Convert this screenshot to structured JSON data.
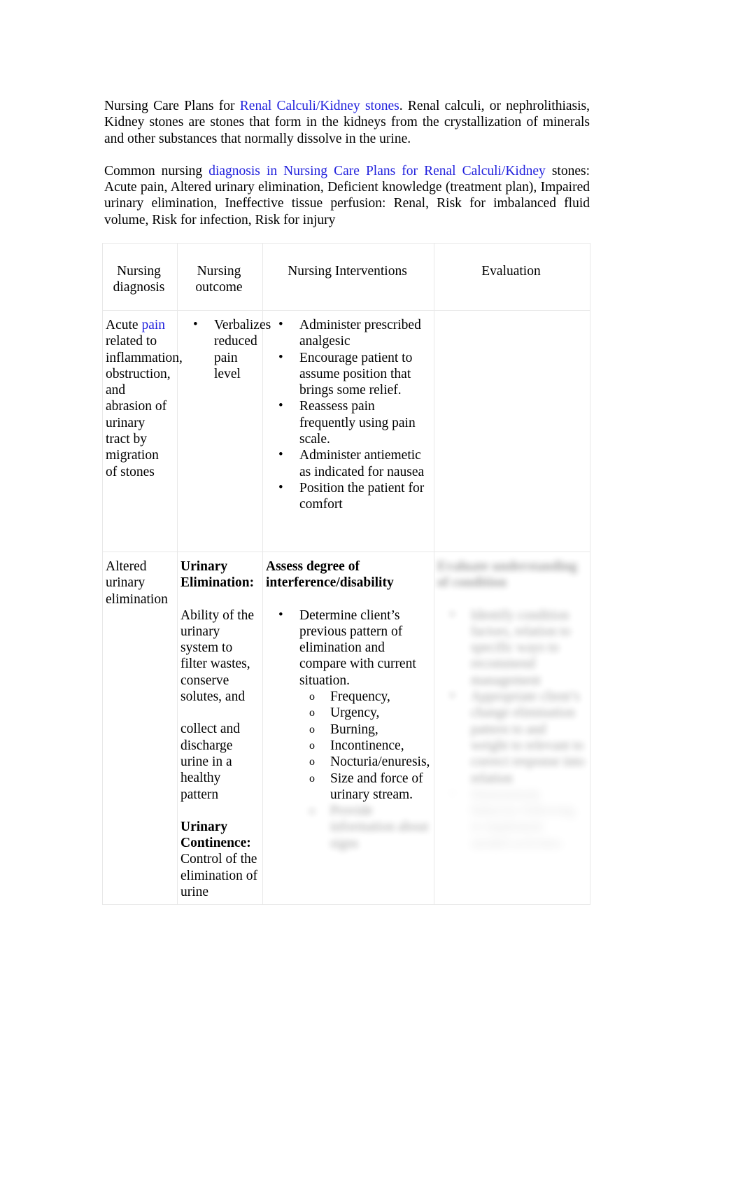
{
  "document": {
    "intro_paragraph": {
      "lead": "Nursing Care Plans for ",
      "link": "Renal Calculi/Kidney stones",
      "rest": ". Renal calculi, or nephrolithiasis, Kidney stones are stones that form in the kidneys from the crystallization of minerals and other substances that normally dissolve in the urine."
    },
    "second_paragraph": {
      "lead": "Common nursing ",
      "link": "diagnosis  in Nursing Care Plans for Renal Calculi/Kidney",
      "rest": " stones: Acute pain, Altered urinary elimination, Deficient knowledge (treatment plan), Impaired urinary elimination, Ineffective tissue perfusion: Renal, Risk for imbalanced fluid volume, Risk for infection, Risk for injury"
    }
  },
  "table": {
    "headers": {
      "diagnosis": "Nursing diagnosis",
      "outcome": "Nursing outcome",
      "interventions": "Nursing Interventions",
      "evaluation": "Evaluation"
    },
    "rows": [
      {
        "diagnosis_lead": "Acute ",
        "diagnosis_link": "pain",
        "diagnosis_rest": " related to inflammation, obstruction, and abrasion of urinary tract by migration of stones",
        "outcome_items": [
          "Verbalizes reduced pain level"
        ],
        "intervention_items": [
          "Administer prescribed analgesic",
          "Encourage patient to assume position that brings some relief.",
          "Reassess pain frequently using pain scale.",
          "Administer antiemetic as indicated for nausea",
          "Position the patient for comfort"
        ],
        "evaluation_text": ""
      },
      {
        "diagnosis_text": "Altered urinary elimination",
        "outcome_heading_1": "Urinary Elimination:",
        "outcome_body_1a": "Ability of the urinary system to filter wastes, conserve solutes, and",
        "outcome_body_1b": "collect and discharge urine in a healthy pattern",
        "outcome_heading_2": "Urinary Continence:",
        "outcome_body_2": "Control of the elimination of urine",
        "intervention_heading": "Assess degree of interference/disability",
        "intervention_items": [
          "Determine client’s previous pattern of elimination and compare with current situation."
        ],
        "intervention_subitems": [
          "Frequency,",
          "Urgency,",
          "Burning,",
          "Incontinence,",
          "Nocturia/enuresis,",
          "Size and force of urinary stream."
        ],
        "intervention_trailing": "Provide information about signs",
        "evaluation_heading": "Evaluate understanding of condition",
        "evaluation_items": [
          "Identify condition factors, relation to specific ways to recommend management",
          "Appropriate client’s change elimination pattern to and weight to relevant to correct response into relation",
          "Demonstrate behavior following to implement needed activities"
        ]
      }
    ]
  },
  "colors": {
    "link": "#2222dd",
    "text": "#000000",
    "table_border": "#e8e8e8"
  }
}
